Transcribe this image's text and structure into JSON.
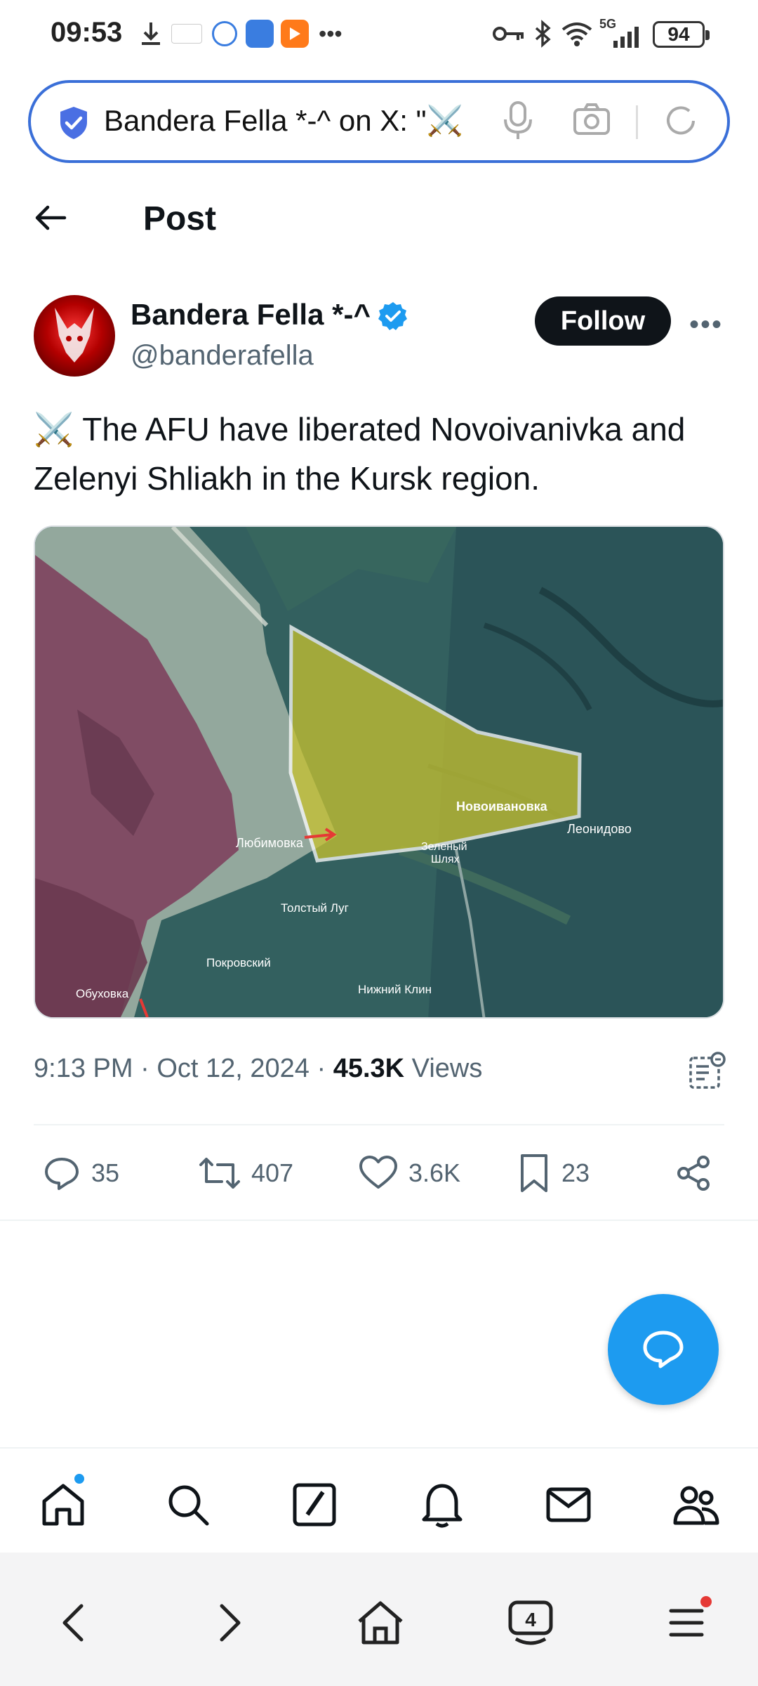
{
  "status_bar": {
    "time": "09:53",
    "battery": "94",
    "network": "5G"
  },
  "browser": {
    "url_text": "Bandera Fella *-^ on X: \"⚔️"
  },
  "header": {
    "title": "Post"
  },
  "post": {
    "author_name": "Bandera Fella *-^",
    "handle": "@banderafella",
    "follow_label": "Follow",
    "text_emoji": "⚔️",
    "text": "The AFU have liberated Novoivanivka and Zelenyi Shliakh in the Kursk region.",
    "map_labels": {
      "novoivanovka": "Новоивановка",
      "leonidovo": "Леонидово",
      "lyubimovka": "Любимовка",
      "zeleny": "Зеленый",
      "shlyakh": "Шлях",
      "tolsty_lug": "Толстый Луг",
      "pokrovsky": "Покровский",
      "obukhovka": "Обуховка",
      "nizhny_klin": "Нижний Клин"
    },
    "time": "9:13 PM",
    "date": "Oct 12, 2024",
    "views_count": "45.3K",
    "views_label": "Views"
  },
  "actions": {
    "replies": "35",
    "reposts": "407",
    "likes": "3.6K",
    "bookmarks": "23"
  },
  "colors": {
    "accent": "#1d9bf0",
    "url_border": "#3a6fd8",
    "dark": "#0f1419",
    "muted": "#536471"
  }
}
